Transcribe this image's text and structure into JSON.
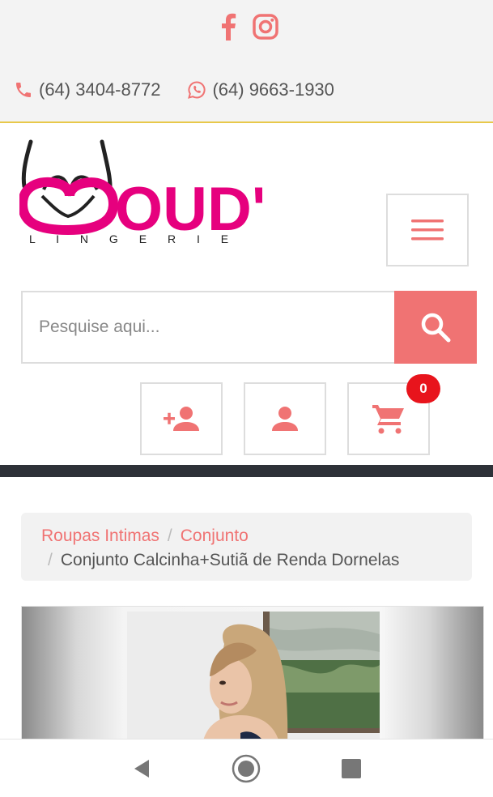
{
  "topbar": {
    "social": [
      {
        "icon": "facebook-icon"
      },
      {
        "icon": "instagram-icon"
      }
    ],
    "phone": {
      "icon": "phone-icon",
      "number": "(64) 3404-8772"
    },
    "whatsapp": {
      "icon": "whatsapp-icon",
      "number": "(64) 9663-1930"
    }
  },
  "brand": {
    "logo_main": "OUD'S",
    "logo_sub": "L I N G E R I E"
  },
  "search": {
    "placeholder": "Pesquise aqui..."
  },
  "actions": {
    "register_icon": "add-user-icon",
    "account_icon": "user-icon",
    "cart_icon": "cart-icon",
    "cart_count": "0"
  },
  "breadcrumb": {
    "items": [
      "Roupas Intimas",
      "Conjunto"
    ],
    "separator": "/",
    "current": "Conjunto Calcinha+Sutiã de Renda Dornelas"
  },
  "colors": {
    "accent": "#f07373",
    "logo_pink": "#e6007e",
    "badge": "#e8141c",
    "dark_bar": "#2e3138"
  }
}
